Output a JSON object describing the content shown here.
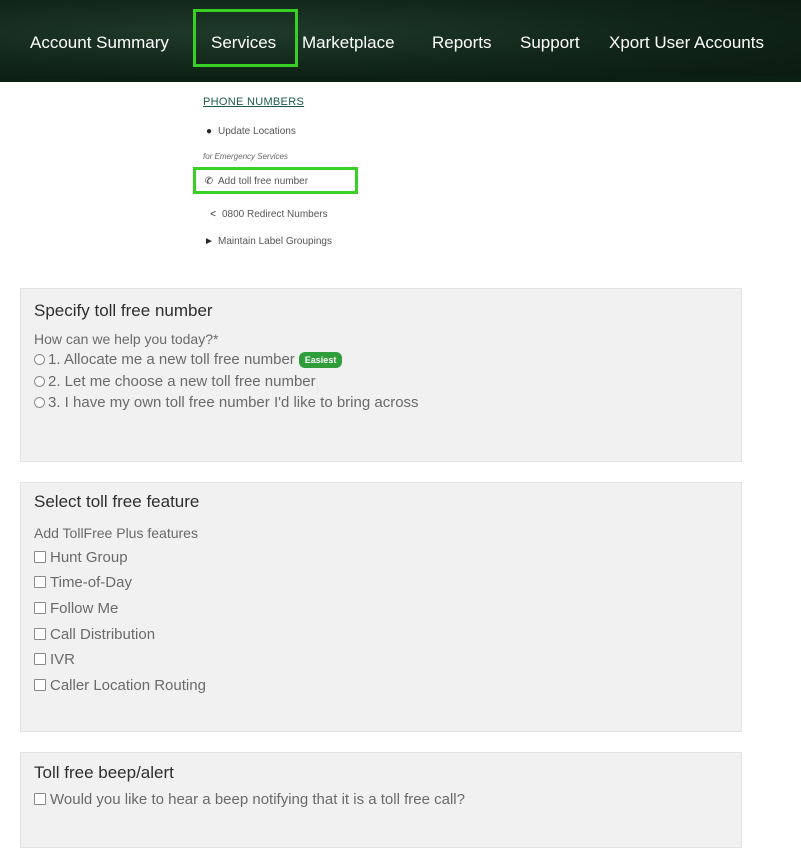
{
  "nav": {
    "items": [
      {
        "label": "Account Summary"
      },
      {
        "label": "Services"
      },
      {
        "label": "Marketplace"
      },
      {
        "label": "Reports"
      },
      {
        "label": "Support"
      },
      {
        "label": "Xport User Accounts"
      }
    ]
  },
  "submenu": {
    "heading": "PHONE NUMBERS",
    "items": [
      {
        "label": "Update Locations",
        "icon": "map-marker-icon"
      },
      {
        "label": "Add toll free number",
        "icon": "phone-icon"
      },
      {
        "label": "0800 Redirect Numbers",
        "icon": "share-icon"
      },
      {
        "label": "Maintain Label Groupings",
        "icon": "tag-icon"
      }
    ],
    "note": "for Emergency Services"
  },
  "panel1": {
    "title": "Specify toll free number",
    "question": "How can we help you today?*",
    "options": [
      {
        "label": "1. Allocate me a new toll free number",
        "badge": "Easiest"
      },
      {
        "label": "2. Let me choose a new toll free number"
      },
      {
        "label": "3. I have my own toll free number I'd like to bring across"
      }
    ]
  },
  "panel2": {
    "title": "Select toll free feature",
    "subtitle": "Add TollFree Plus features",
    "options": [
      {
        "label": "Hunt Group"
      },
      {
        "label": "Time-of-Day"
      },
      {
        "label": "Follow Me"
      },
      {
        "label": "Call Distribution"
      },
      {
        "label": "IVR"
      },
      {
        "label": "Caller Location Routing"
      }
    ]
  },
  "panel3": {
    "title": "Toll free beep/alert",
    "option": "Would you like to hear a beep notifying that it is a toll free call?"
  },
  "colors": {
    "highlight": "#39d026",
    "badge": "#2f9e3a",
    "nav_bg": "#102418"
  }
}
